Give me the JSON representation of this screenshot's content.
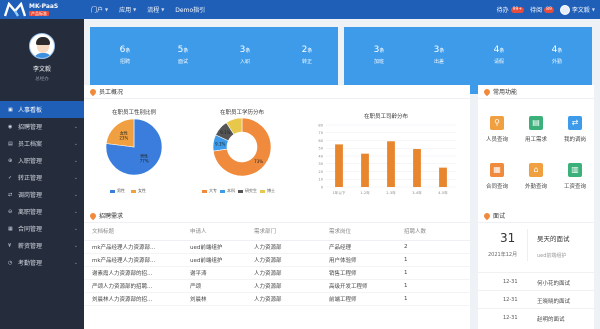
{
  "header": {
    "logo_name": "MK-PaaS",
    "logo_sub": "产品标准",
    "nav": [
      "门户",
      "应用",
      "流程",
      "Demo指引"
    ],
    "todo_label": "待办",
    "todo_count": "99+",
    "notice_label": "待阅",
    "notice_count": "89",
    "user_name": "李文毅"
  },
  "sidebar": {
    "name": "李文毅",
    "role": "总经办",
    "items": [
      {
        "label": "人事看板",
        "active": true
      },
      {
        "label": "招聘管理"
      },
      {
        "label": "员工档案"
      },
      {
        "label": "入职管理"
      },
      {
        "label": "转正管理"
      },
      {
        "label": "调岗管理"
      },
      {
        "label": "离职管理"
      },
      {
        "label": "合同管理"
      },
      {
        "label": "薪资管理"
      },
      {
        "label": "考勤管理"
      }
    ]
  },
  "stats_left": [
    {
      "num": "6",
      "unit": "条",
      "label": "招聘"
    },
    {
      "num": "5",
      "unit": "条",
      "label": "面试"
    },
    {
      "num": "3",
      "unit": "条",
      "label": "入职"
    },
    {
      "num": "2",
      "unit": "条",
      "label": "转正"
    }
  ],
  "stats_right": [
    {
      "num": "3",
      "unit": "条",
      "label": "加班"
    },
    {
      "num": "3",
      "unit": "条",
      "label": "出差"
    },
    {
      "num": "4",
      "unit": "条",
      "label": "请假"
    },
    {
      "num": "4",
      "unit": "条",
      "label": "外勤"
    }
  ],
  "overview": {
    "title": "员工概况",
    "chart1_title": "在职员工性别比例",
    "chart2_title": "在职员工学历分布",
    "chart3_title": "在职员工司龄分布"
  },
  "chart_data": [
    {
      "type": "pie",
      "title": "在职员工性别比例",
      "categories": [
        "男性",
        "女性"
      ],
      "values": [
        77,
        23
      ],
      "labels": [
        "男性\n77%",
        "女性\n23%"
      ],
      "colors": [
        "#3b7ddd",
        "#f0a040"
      ],
      "legend": "bottom"
    },
    {
      "type": "pie",
      "title": "在职员工学历分布",
      "donut": true,
      "categories": [
        "大专",
        "本科",
        "研究生",
        "博士"
      ],
      "values": [
        73,
        9.1,
        9.1,
        9.1
      ],
      "labels": [
        "73%",
        "9.1%",
        "9.1%",
        ""
      ],
      "colors": [
        "#f08a3c",
        "#3d9be9",
        "#555555",
        "#e8c84a"
      ],
      "legend": "bottom"
    },
    {
      "type": "bar",
      "title": "在职员工司龄分布",
      "categories": [
        "1年以下",
        "1-2年",
        "2-3年",
        "3-4年",
        "4-5年"
      ],
      "values": [
        55,
        43,
        59,
        49,
        25
      ],
      "ylim": [
        0,
        80
      ],
      "yticks": [
        0,
        10,
        20,
        30,
        40,
        50,
        60,
        70,
        80
      ],
      "color": "#e8862e",
      "grid": true
    }
  ],
  "functions": {
    "title": "常用功能",
    "items": [
      {
        "label": "人员查询",
        "icon": "person-search-icon",
        "color": "#f0a040",
        "glyph": "👤"
      },
      {
        "label": "用工需求",
        "icon": "briefcase-icon",
        "color": "#3bb07a",
        "glyph": "▤"
      },
      {
        "label": "我的调岗",
        "icon": "transfer-icon",
        "color": "#3d9be9",
        "glyph": "⇄"
      },
      {
        "label": "合同查询",
        "icon": "contract-icon",
        "color": "#f08a3c",
        "glyph": "▦"
      },
      {
        "label": "外勤查询",
        "icon": "field-work-icon",
        "color": "#f0a040",
        "glyph": "⌂"
      },
      {
        "label": "工资查询",
        "icon": "salary-icon",
        "color": "#3bb07a",
        "glyph": "▥"
      }
    ]
  },
  "recruit": {
    "title": "招聘需求",
    "columns": [
      "文档标题",
      "申请人",
      "需求部门",
      "需求岗位",
      "招聘人数"
    ],
    "rows": [
      [
        "mk产品经理人力资源部...",
        "ued前端组护",
        "人力资源部",
        "产品经理",
        "2"
      ],
      [
        "mk产品经理人力资源部...",
        "ued前端组护",
        "人力资源部",
        "用户体验师",
        "1"
      ],
      [
        "谢素霞人力资源部的招...",
        "谢平涛",
        "人力资源部",
        "销售工程师",
        "1"
      ],
      [
        "严颂人力资源部的招聘...",
        "严颂",
        "人力资源部",
        "高级开发工程师",
        "1"
      ],
      [
        "刘晨林人力资源部的招...",
        "刘晨林",
        "人力资源部",
        "前端工程师",
        "1"
      ]
    ]
  },
  "interview": {
    "title": "面试",
    "day": "31",
    "date": "2021年12月",
    "event_title": "吴天的面试",
    "event_note": "ued前端组护",
    "list": [
      {
        "date": "12-31",
        "title": "何小花的面试"
      },
      {
        "date": "12-31",
        "title": "王晓晓的面试"
      },
      {
        "date": "12-31",
        "title": "赵明的面试"
      }
    ]
  }
}
